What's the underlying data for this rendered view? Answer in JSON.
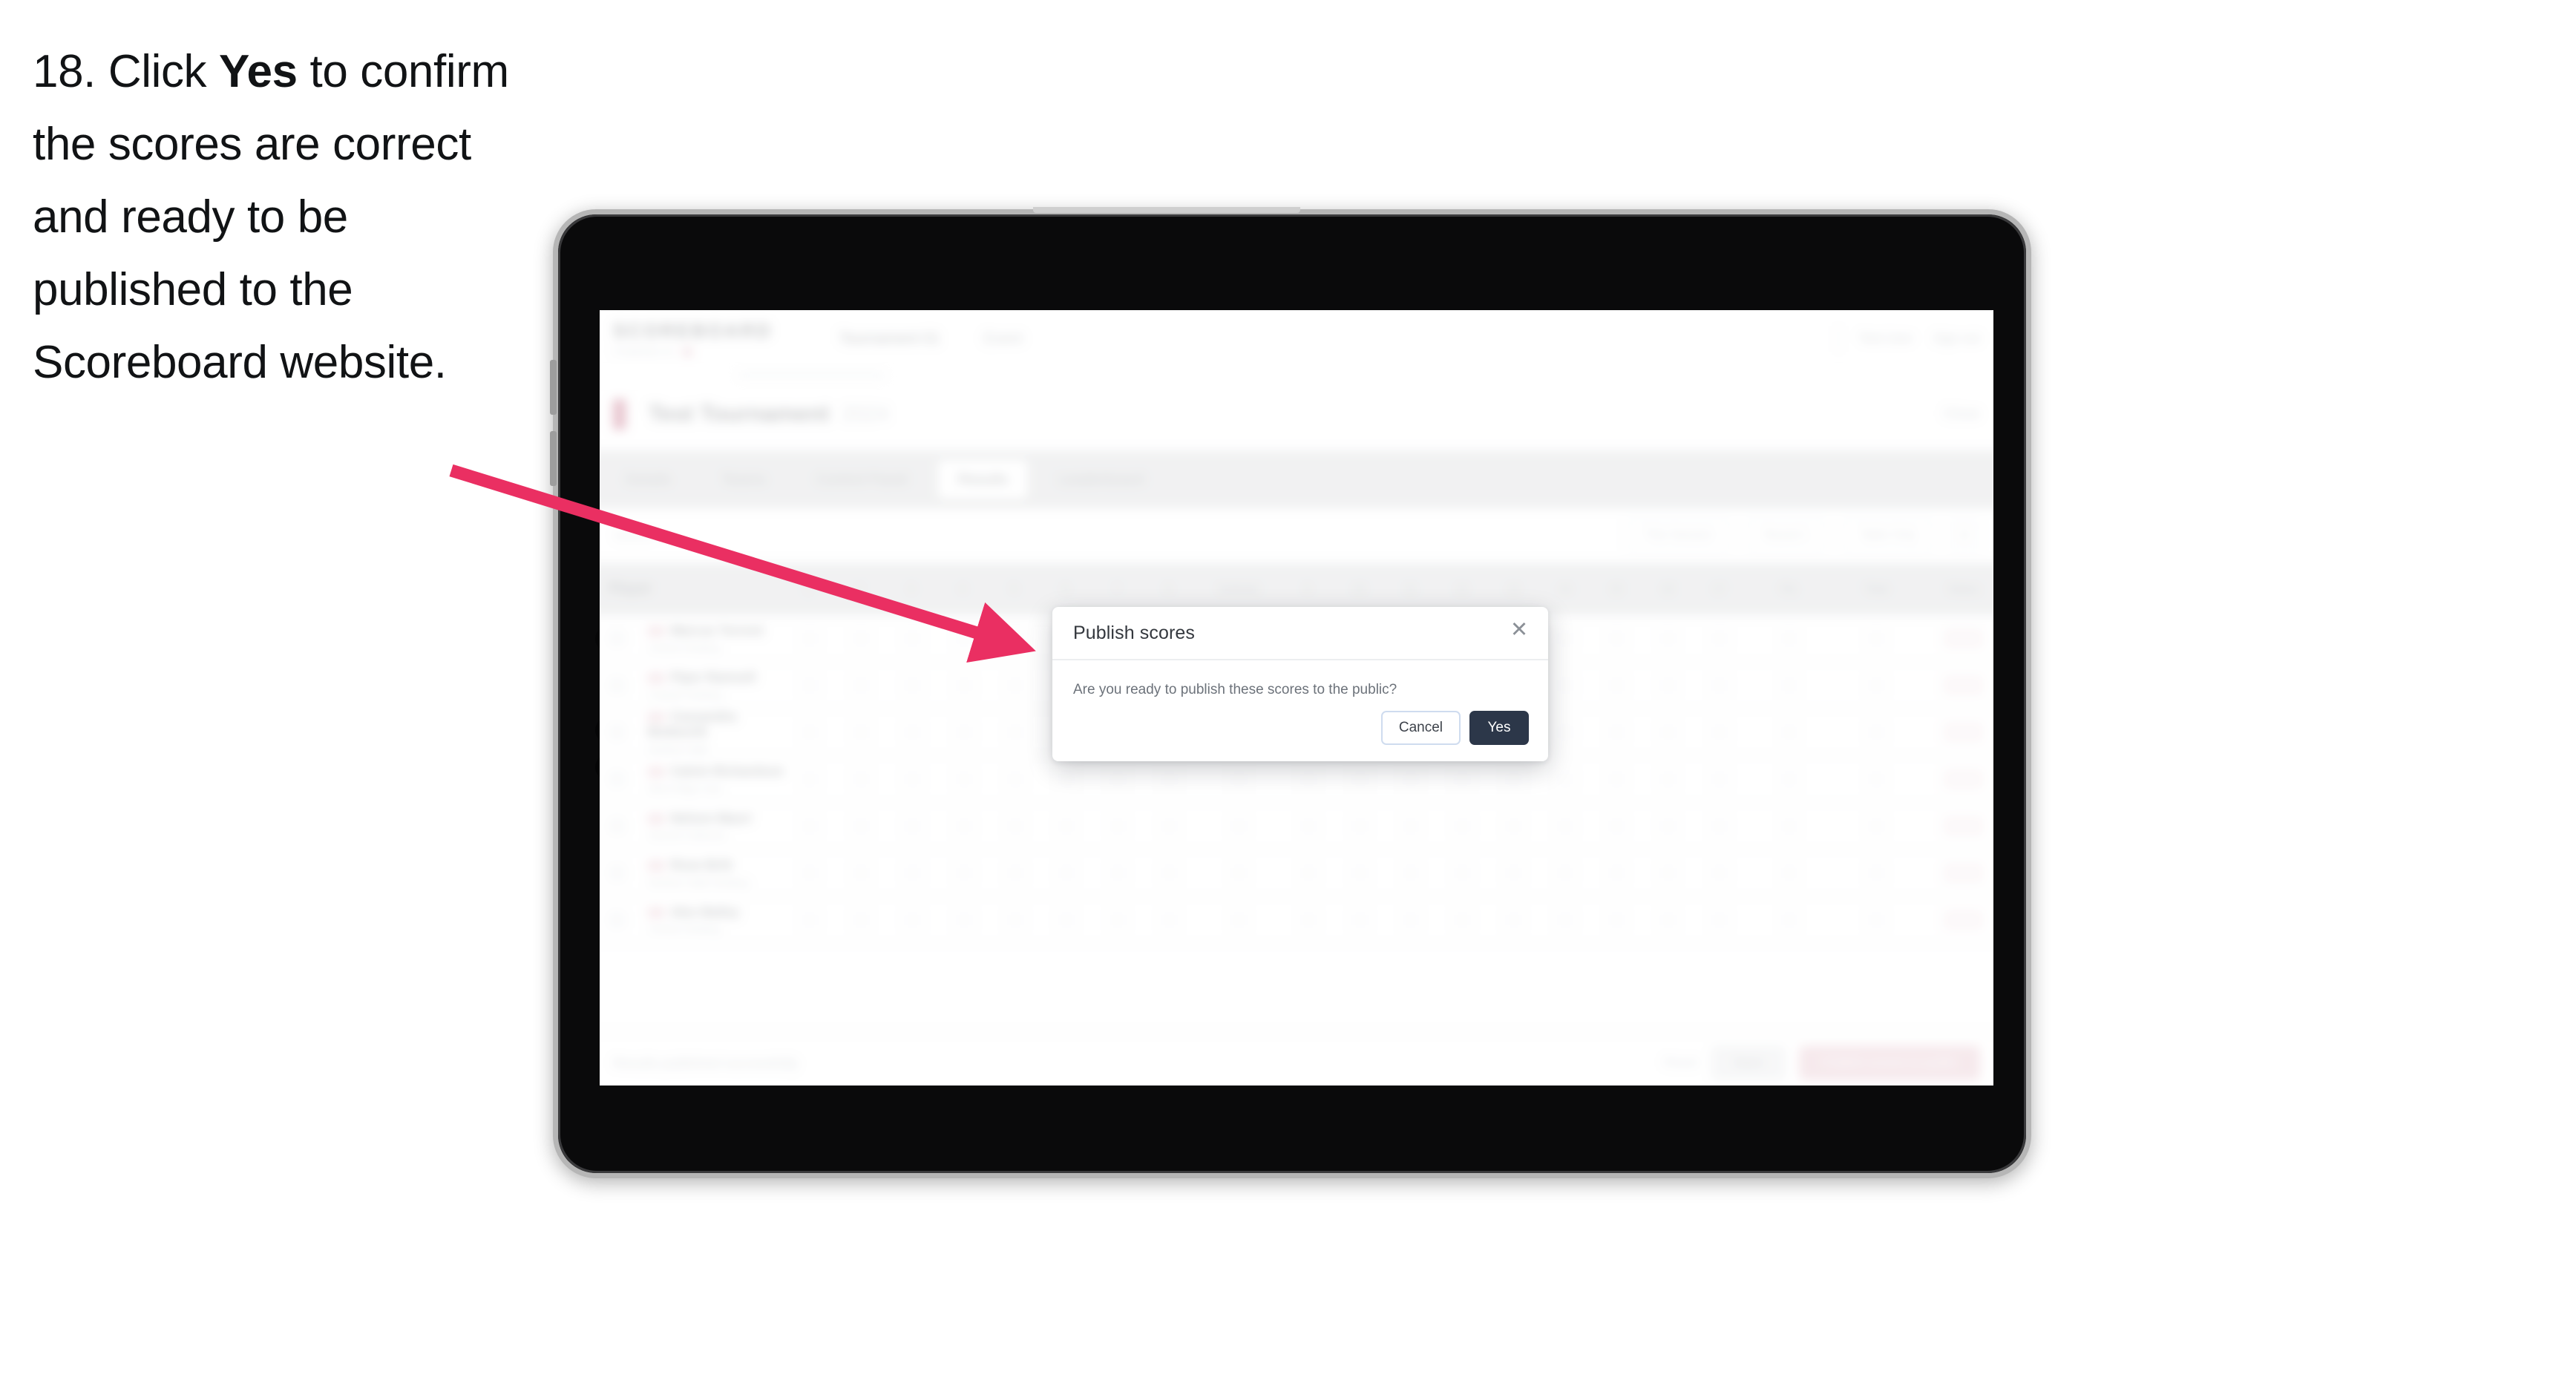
{
  "instruction": {
    "number": "18.",
    "text_before": "Click",
    "bold_word": "Yes",
    "text_after": "to confirm the scores are correct and ready to be published to the Scoreboard website."
  },
  "annotation": {
    "arrow_color": "#ea2f62",
    "points_to": "yes-button"
  },
  "device": {
    "type": "tablet",
    "frame_color": "#0a0a0b",
    "bezel_color": "#b6b6b6"
  },
  "app": {
    "header": {
      "brand": "SCOREBOARD",
      "brand_sub": "POWERED BY",
      "nav": [
        {
          "label": "Tournament 01"
        },
        {
          "label": "Event"
        }
      ],
      "right": [
        {
          "label": "Test User"
        },
        {
          "label": "Sign out"
        }
      ]
    },
    "title_row": {
      "title": "Test Tournament",
      "subtitle": "2024",
      "right_label": "Close"
    },
    "tabs": [
      {
        "label": "Details",
        "active": false
      },
      {
        "label": "Teams",
        "active": false
      },
      {
        "label": "Control Panel",
        "active": false
      },
      {
        "label": "Results",
        "active": true
      },
      {
        "label": "Leaderboard",
        "active": false
      }
    ],
    "filter_bar": {
      "search_placeholder": "Search",
      "pills": [
        {
          "label": "This Session"
        },
        {
          "label": "Round 1"
        },
        {
          "label": "Table Only"
        }
      ],
      "icon_button": "filter-icon"
    },
    "table": {
      "columns": [
        {
          "label": "Player",
          "key": "player"
        },
        {
          "label": "1"
        },
        {
          "label": "2"
        },
        {
          "label": "3"
        },
        {
          "label": "4"
        },
        {
          "label": "5"
        },
        {
          "label": "6"
        },
        {
          "label": "7"
        },
        {
          "label": "8"
        },
        {
          "label": "Subtotal"
        },
        {
          "label": "9"
        },
        {
          "label": "10"
        },
        {
          "label": "11"
        },
        {
          "label": "12"
        },
        {
          "label": "13"
        },
        {
          "label": "14"
        },
        {
          "label": "15"
        },
        {
          "label": "16"
        },
        {
          "label": "17"
        },
        {
          "label": "Pts"
        },
        {
          "label": "Total"
        },
        {
          "label": "Status"
        }
      ],
      "rows": [
        {
          "name": "Marcus Torrent",
          "club": "Central Climbing"
        },
        {
          "name": "Piper Ramsell",
          "club": "Coastal Climbing"
        },
        {
          "name": "Cassandra Bedworth",
          "club": "Northern Wall"
        },
        {
          "name": "Calvin Richardson",
          "club": "West Ridge Club"
        },
        {
          "name": "Nelson Mauri",
          "club": "Summit Collective"
        },
        {
          "name": "Rose Britt",
          "club": "Northern Wall Climbing"
        },
        {
          "name": "Alex Bailey",
          "club": "Central Climbing"
        }
      ]
    },
    "footer": {
      "note": "Results published successfully",
      "link": "Reset",
      "secondary_button": "Save",
      "primary_button": "Publish scores to public"
    }
  },
  "modal": {
    "title": "Publish scores",
    "message": "Are you ready to publish these scores to the public?",
    "close_icon": "close-icon",
    "cancel_label": "Cancel",
    "confirm_label": "Yes",
    "confirm_color": "#2c3749"
  }
}
